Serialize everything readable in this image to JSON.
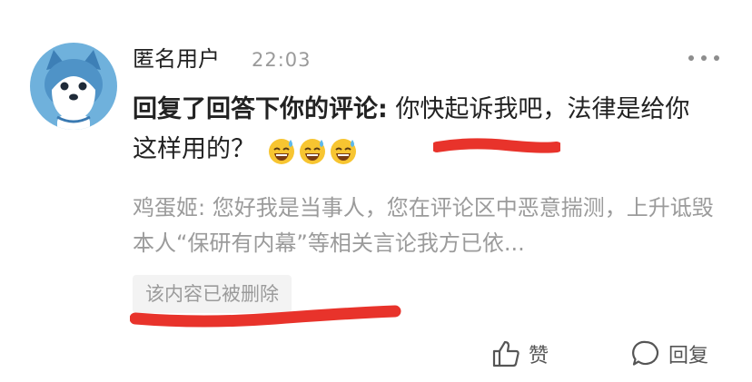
{
  "comment": {
    "username": "匿名用户",
    "time": "22:03",
    "reply_lead": "回复了回答下你的评论:",
    "reply_text": "你快起诉我吧，法律是给你这样用的？",
    "emojis": [
      "sweat-smile-emoji",
      "sweat-smile-emoji",
      "sweat-smile-emoji"
    ],
    "quoted_author": "鸡蛋姬:",
    "quoted_text": "您好我是当事人，您在评论区中恶意揣测，上升诋毁本人“保研有内幕”等相关言论我方已依...",
    "deleted_notice": "该内容已被删除"
  },
  "actions": {
    "like_label": "赞",
    "reply_label": "回复"
  },
  "colors": {
    "avatar_bg": "#6fb1dc",
    "annotation_red": "#e8332b",
    "muted_text": "#9b9b9b"
  }
}
